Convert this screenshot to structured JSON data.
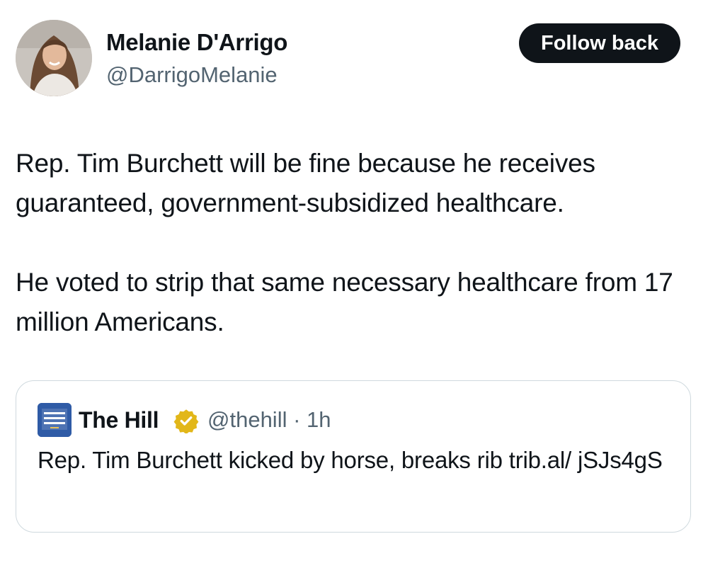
{
  "author": {
    "display_name": "Melanie D'Arrigo",
    "handle": "@DarrigoMelanie",
    "avatar_icon": "profile-photo"
  },
  "follow_button": {
    "label": "Follow back"
  },
  "tweet": {
    "paragraphs": [
      "Rep. Tim Burchett will be fine because he receives guaranteed, government-subsidized healthcare.",
      "He voted to strip that same necessary healthcare from 17 million Americans."
    ]
  },
  "quoted_tweet": {
    "logo_icon": "the-hill-logo",
    "display_name": "The Hill",
    "verified_icon": "gold-verified-badge",
    "handle": "@thehill",
    "separator": "·",
    "time": "1h",
    "text": "Rep. Tim Burchett kicked by horse, breaks rib trib.al/ jSJs4gS"
  },
  "colors": {
    "text_primary": "#0f1419",
    "text_secondary": "#536471",
    "button_bg": "#0f1419",
    "border": "#cfd9de",
    "verified_gold": "#e2b719",
    "hill_blue": "#2f5ba6"
  }
}
